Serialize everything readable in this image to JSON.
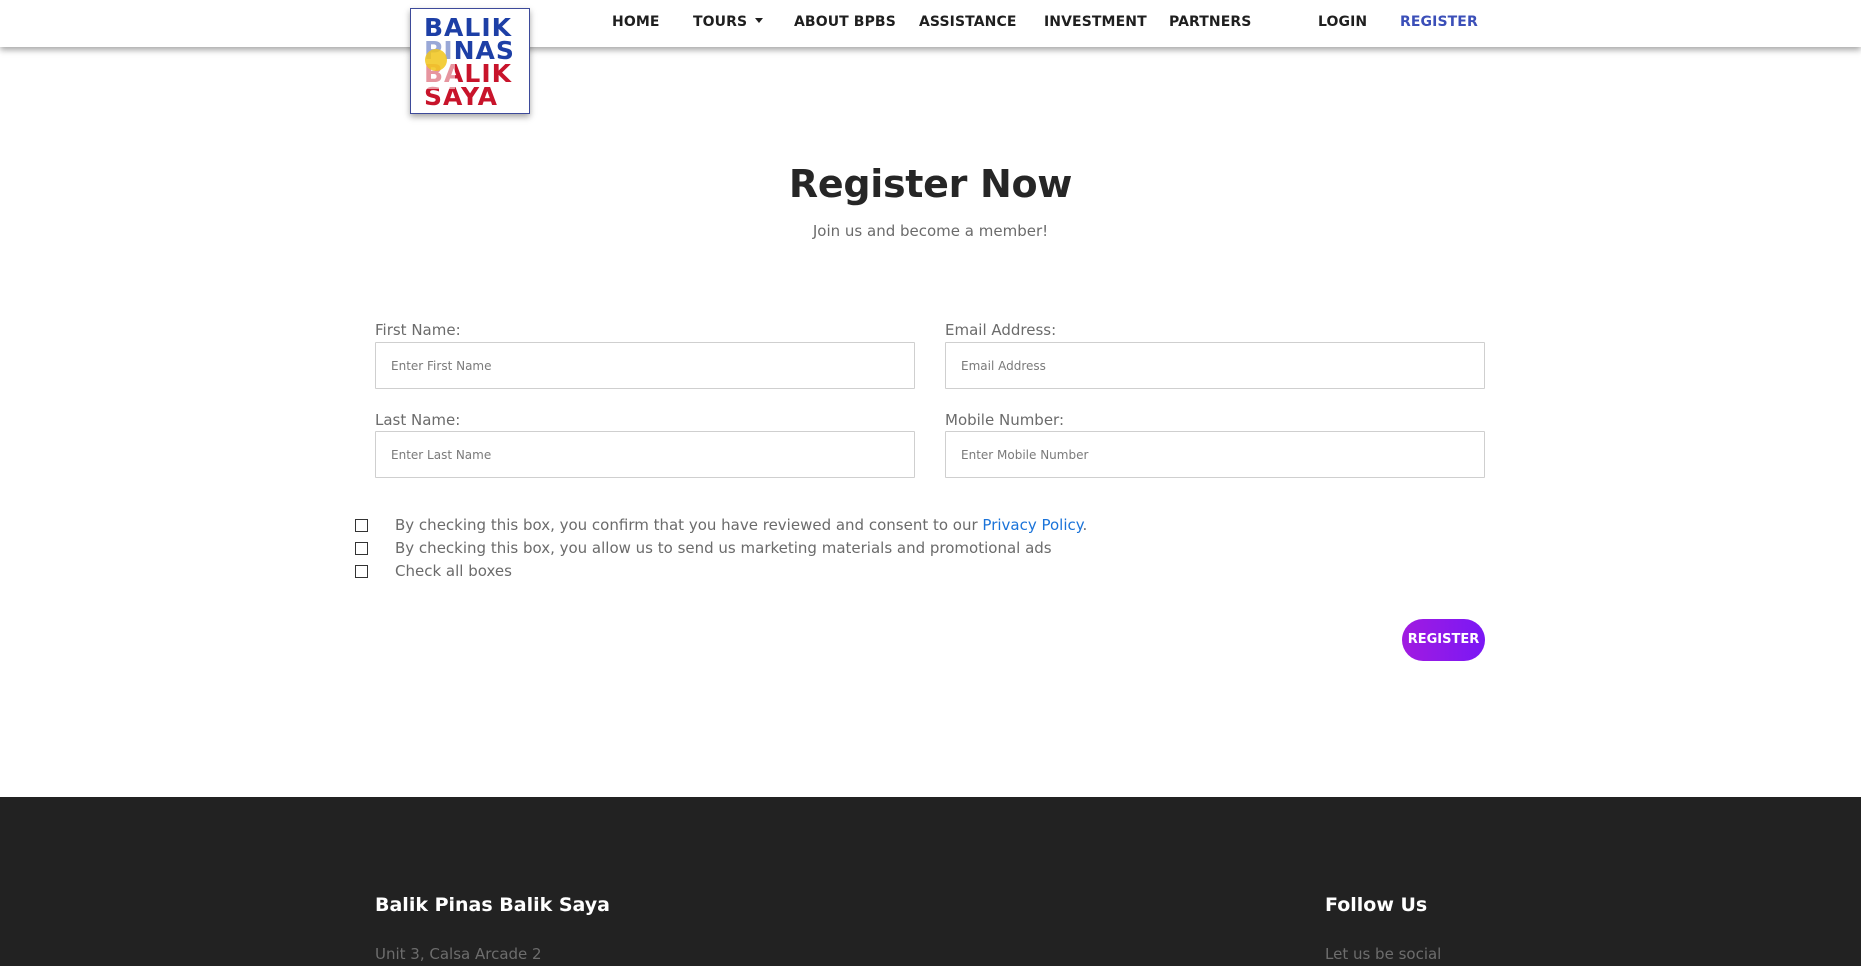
{
  "nav": {
    "home": "HOME",
    "tours": "TOURS",
    "about": "ABOUT BPBS",
    "assistance": "ASSISTANCE",
    "investment": "INVESTMENT",
    "partners": "PARTNERS",
    "login": "LOGIN",
    "register": "REGISTER"
  },
  "logo": {
    "line1": "BALIK",
    "line2": "PINAS",
    "line3": "BALIK",
    "line4": "SAYA"
  },
  "heading": {
    "title": "Register Now",
    "subtitle": "Join us and become a member!"
  },
  "form": {
    "first_name_label": "First Name:",
    "first_name_placeholder": "Enter First Name",
    "email_label": "Email Address:",
    "email_placeholder": "Email Address",
    "last_name_label": "Last Name:",
    "last_name_placeholder": "Enter Last Name",
    "mobile_label": "Mobile Number:",
    "mobile_placeholder": "Enter Mobile Number",
    "consent_text": "By checking this box, you confirm that you have reviewed and consent to our ",
    "privacy_link": "Privacy Policy",
    "consent_suffix": ".",
    "marketing_text": "By checking this box, you allow us to send us marketing materials and promotional ads",
    "check_all_text": "Check all boxes",
    "submit_label": "REGISTER"
  },
  "footer": {
    "brand_title": "Balik Pinas Balik Saya",
    "address": "Unit 3, Calsa Arcade 2",
    "follow_title": "Follow Us",
    "follow_text": "Let us be social"
  },
  "colors": {
    "nav_active": "#3b4fb8",
    "button_gradient_start": "#a11be0",
    "button_gradient_end": "#7a18f5",
    "link": "#1a73d9",
    "footer_bg": "#222222"
  }
}
